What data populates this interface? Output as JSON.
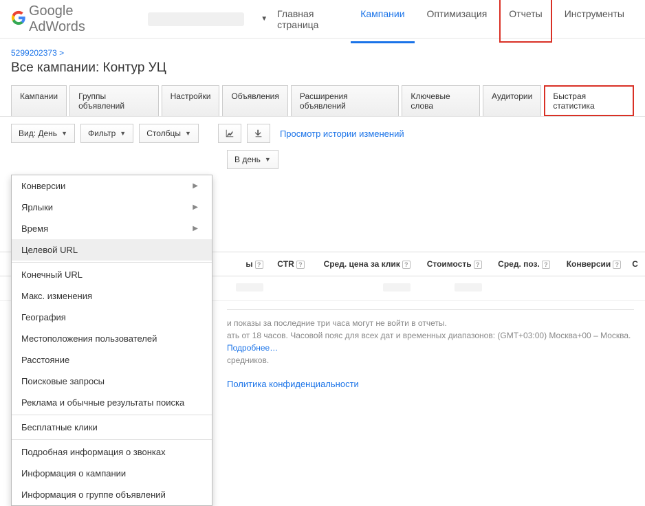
{
  "header": {
    "logo": "Google AdWords",
    "nav": {
      "home": "Главная страница",
      "campaigns": "Кампании",
      "optimization": "Оптимизация",
      "reports": "Отчеты",
      "tools": "Инструменты"
    }
  },
  "breadcrumb": {
    "id": "5299202373",
    "sep": ">"
  },
  "page_title": "Все кампании: Контур УЦ",
  "subtabs": {
    "campaigns": "Кампании",
    "adgroups": "Группы объявлений",
    "settings": "Настройки",
    "ads": "Объявления",
    "extensions": "Расширения объявлений",
    "keywords": "Ключевые слова",
    "audiences": "Аудитории",
    "dimensions": "Быстрая статистика"
  },
  "toolbar": {
    "view": "Вид: День",
    "filter": "Фильтр",
    "columns": "Столбцы",
    "history": "Просмотр истории изменений",
    "per_day": "В день"
  },
  "dropdown": {
    "items": [
      {
        "label": "Конверсии",
        "sub": true
      },
      {
        "label": "Ярлыки",
        "sub": true
      },
      {
        "label": "Время",
        "sub": true
      },
      {
        "label": "Целевой URL",
        "sep_after": true,
        "selected": true
      },
      {
        "label": "Конечный URL"
      },
      {
        "label": "Макс. изменения"
      },
      {
        "label": "География"
      },
      {
        "label": "Местоположения пользователей"
      },
      {
        "label": "Расстояние"
      },
      {
        "label": "Поисковые запросы"
      },
      {
        "label": "Реклама и обычные результаты поиска",
        "sep_after": true
      },
      {
        "label": "Бесплатные клики",
        "sep_after": true
      },
      {
        "label": "Подробная информация о звонках"
      },
      {
        "label": "Информация о кампании"
      },
      {
        "label": "Информация о группе объявлений"
      }
    ]
  },
  "table": {
    "cols": {
      "impr_tail": "ы",
      "ctr": "CTR",
      "avg_cpc": "Сред. цена за клик",
      "cost": "Стоимость",
      "avg_pos": "Сред. поз.",
      "conv": "Конверсии",
      "last": "С"
    }
  },
  "footer": {
    "line1": "и показы за последние три часа могут не войти в отчеты.",
    "line2": "ать от 18 часов. Часовой пояс для всех дат и временных диапазонов: (GMT+03:00) Москва+00 – Москва.",
    "line3": "средников.",
    "more": "Подробнее…",
    "privacy": "Политика конфиденциальности"
  }
}
